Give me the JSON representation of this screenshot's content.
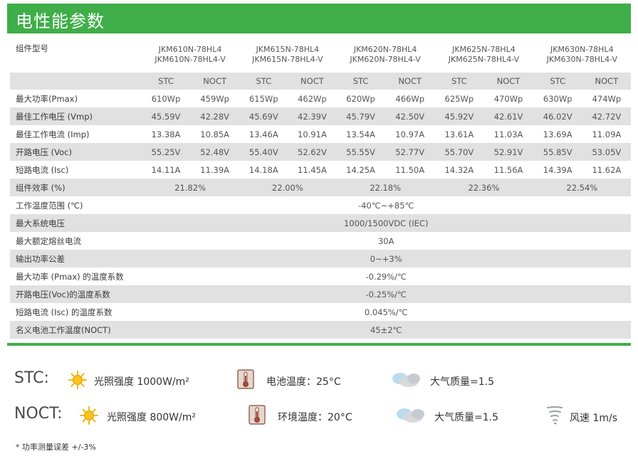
{
  "header": {
    "title": "电性能参数"
  },
  "table": {
    "model_label": "组件型号",
    "models": [
      {
        "line1": "JKM610N-78HL4",
        "line2": "JKM610N-78HL4-V"
      },
      {
        "line1": "JKM615N-78HL4",
        "line2": "JKM615N-78HL4-V"
      },
      {
        "line1": "JKM620N-78HL4",
        "line2": "JKM620N-78HL4-V"
      },
      {
        "line1": "JKM625N-78HL4",
        "line2": "JKM625N-78HL4-V"
      },
      {
        "line1": "JKM630N-78HL4",
        "line2": "JKM630N-78HL4-V"
      }
    ],
    "stc": "STC",
    "noct": "NOCT",
    "pair_rows": [
      {
        "label": "最大功率(Pmax)",
        "values": [
          "610Wp",
          "459Wp",
          "615Wp",
          "462Wp",
          "620Wp",
          "466Wp",
          "625Wp",
          "470Wp",
          "630Wp",
          "474Wp"
        ]
      },
      {
        "label": "最佳工作电压 (Vmp)",
        "values": [
          "45.59V",
          "42.28V",
          "45.69V",
          "42.39V",
          "45.79V",
          "42.50V",
          "45.92V",
          "42.61V",
          "46.02V",
          "42.72V"
        ]
      },
      {
        "label": "最佳工作电流 (Imp)",
        "values": [
          "13.38A",
          "10.85A",
          "13.46A",
          "10.91A",
          "13.54A",
          "10.97A",
          "13.61A",
          "11.03A",
          "13.69A",
          "11.09A"
        ]
      },
      {
        "label": "开路电压 (Voc)",
        "values": [
          "55.25V",
          "52.48V",
          "55.40V",
          "52.62V",
          "55.55V",
          "52.77V",
          "55.70V",
          "52.91V",
          "55.85V",
          "53.05V"
        ]
      },
      {
        "label": "短路电流 (Isc)",
        "values": [
          "14.11A",
          "11.39A",
          "14.18A",
          "11.45A",
          "14.25A",
          "11.50A",
          "14.32A",
          "11.56A",
          "14.39A",
          "11.62A"
        ]
      }
    ],
    "efficiency": {
      "label": "组件效率 (%)",
      "values": [
        "21.82%",
        "22.00%",
        "22.18%",
        "22.36%",
        "22.54%"
      ]
    },
    "single_rows": [
      {
        "label": "工作温度范围 (℃)",
        "value": "-40℃~+85℃"
      },
      {
        "label": "最大系统电压",
        "value": "1000/1500VDC (IEC)"
      },
      {
        "label": "最大额定熔丝电流",
        "value": "30A"
      },
      {
        "label": "输出功率公差",
        "value": "0~+3%"
      },
      {
        "label": "最大功率 (Pmax) 的温度系数",
        "value": "-0.29%/℃"
      },
      {
        "label": "开路电压(Voc)的温度系数",
        "value": "-0.25%/℃"
      },
      {
        "label": "短路电流 (Isc) 的温度系数",
        "value": "0.045%/℃"
      },
      {
        "label": "名义电池工作温度(NOCT)",
        "value": "45±2℃"
      }
    ]
  },
  "conditions": {
    "stc_title": "STC:",
    "stc_irradiance": "光照强度  1000W/m²",
    "stc_cell_temp": "电池温度：25°C",
    "stc_air_mass": "大气质量=1.5",
    "noct_title": "NOCT:",
    "noct_irradiance": "光照强度  800W/m²",
    "noct_ambient_temp": "环境温度：20°C",
    "noct_air_mass": "大气质量=1.5",
    "noct_wind": "风速 1m/s"
  },
  "footnote": "* 功率测量误差 +/-3%",
  "colors": {
    "brand_green": "#3fae49",
    "row_shade": "#e1e1e1",
    "sun": "#f5b400",
    "thermo": "#b0472e"
  }
}
